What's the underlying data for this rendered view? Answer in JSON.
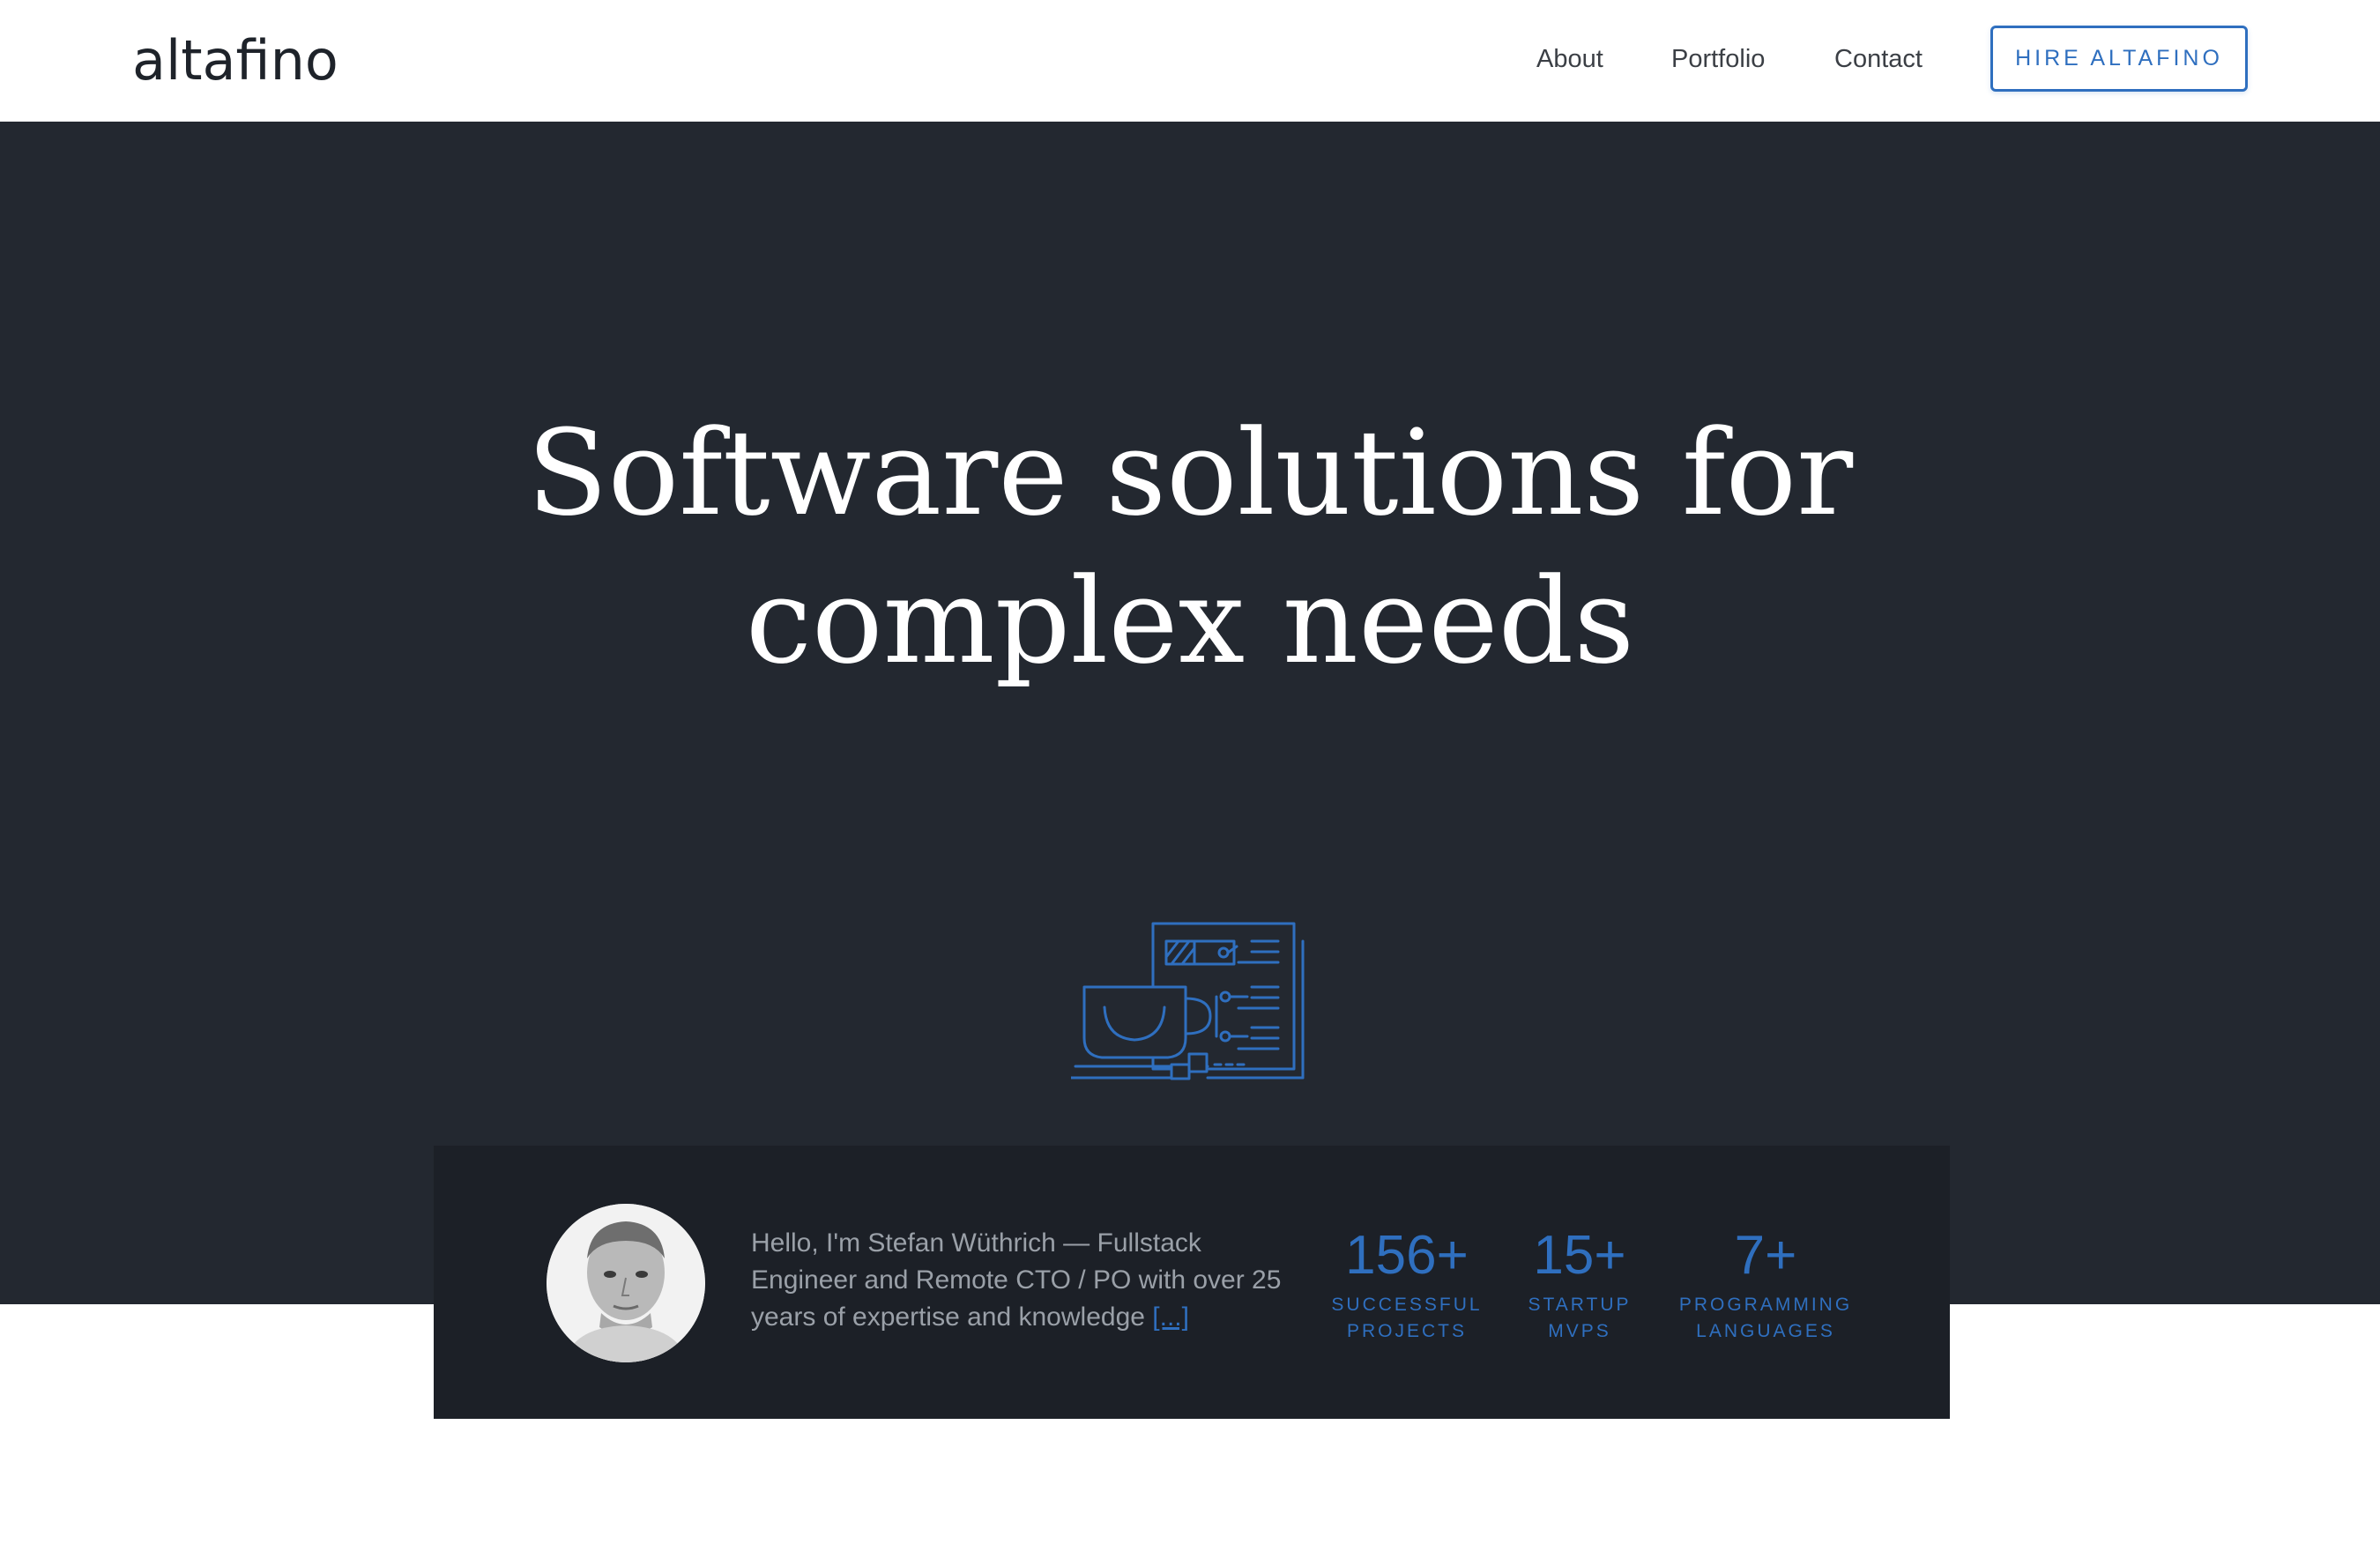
{
  "header": {
    "logo": "altafino",
    "nav": {
      "about": "About",
      "portfolio": "Portfolio",
      "contact": "Contact"
    },
    "hire_button": "HIRE ALTAFINO"
  },
  "hero": {
    "title_line1": "Software solutions for",
    "title_line2": "complex needs",
    "illustration_icon": "coffee-cup-and-document-icon"
  },
  "intro": {
    "bio": "Hello, I'm Stefan Wüthrich — Fullstack Engineer and Remote CTO / PO with over 25 years of expertise and knowledge",
    "bio_more": "[...]",
    "stats": [
      {
        "value": "156+",
        "label": "SUCCESSFUL\nPROJECTS"
      },
      {
        "value": "15+",
        "label": "STARTUP\nMVPS"
      },
      {
        "value": "7+",
        "label": "PROGRAMMING\nLANGUAGES"
      }
    ]
  },
  "colors": {
    "accent": "#2f6fbf",
    "hero_bg": "#232830",
    "intro_bg": "#1c2027",
    "text_muted": "#9aa0a8"
  }
}
